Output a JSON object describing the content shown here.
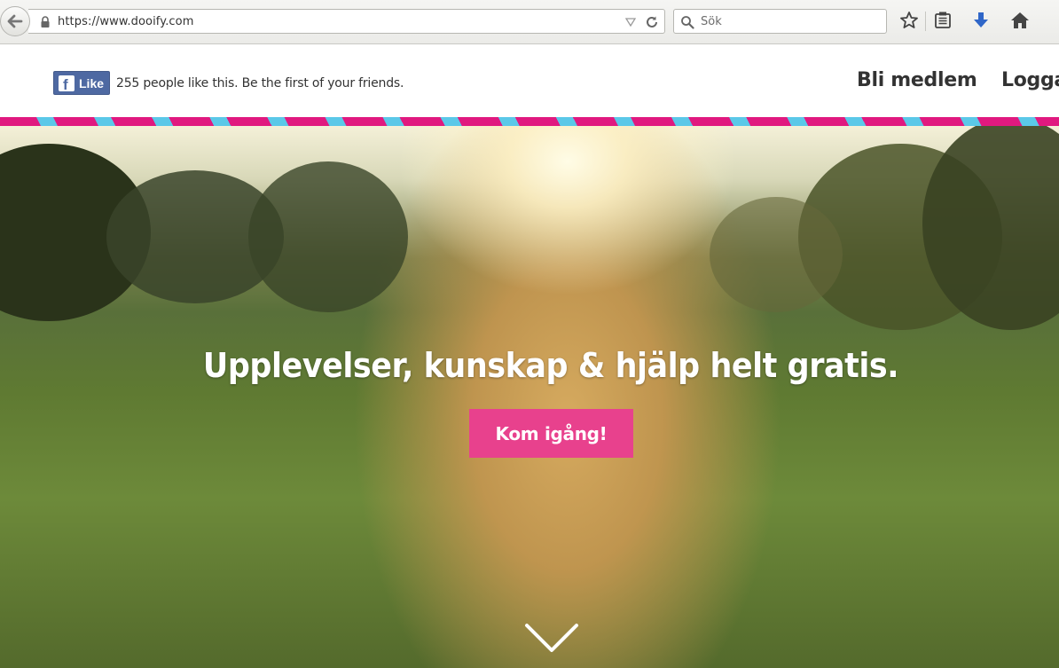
{
  "browser": {
    "url": "https://www.dooify.com",
    "search_placeholder": "Sök"
  },
  "header": {
    "fb_like_label": "Like",
    "fb_like_text": "255 people like this. Be the first of your friends.",
    "nav": [
      "Bli medlem",
      "Logga"
    ]
  },
  "hero": {
    "title": "Upplevelser, kunskap & hjälp helt gratis.",
    "cta_label": "Kom igång!"
  },
  "colors": {
    "accent_pink": "#e8418d",
    "stripe_pink": "#e0197f",
    "stripe_blue": "#5bc8e8",
    "facebook_blue": "#4e69a2"
  },
  "icons": [
    "back-arrow-icon",
    "lock-icon",
    "dropdown-icon",
    "reload-icon",
    "search-icon",
    "bookmark-star-icon",
    "reading-list-icon",
    "download-icon",
    "home-icon",
    "facebook-icon",
    "chevron-down-icon"
  ]
}
